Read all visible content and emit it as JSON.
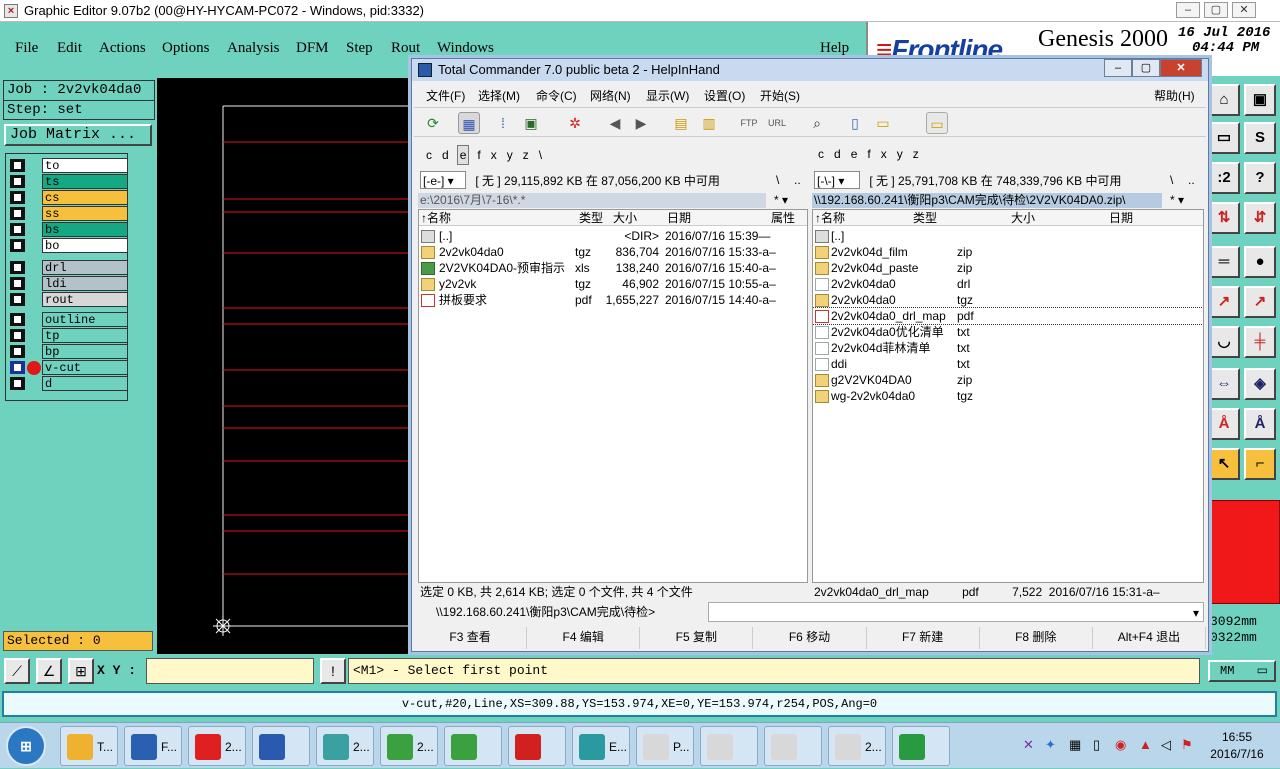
{
  "window": {
    "title": "Graphic Editor 9.07b2 (00@HY-HYCAM-PC072 - Windows, pid:3332)"
  },
  "menu": [
    "File",
    "Edit",
    "Actions",
    "Options",
    "Analysis",
    "DFM",
    "Step",
    "Rout",
    "Windows",
    "Help"
  ],
  "brand": {
    "logo": "Frontline",
    "product": "Genesis 2000",
    "date": "16 Jul 2016",
    "time": "04:44 PM"
  },
  "job": {
    "label": "Job : 2v2vk04da0",
    "step": "Step: set",
    "matrix_button": "Job Matrix ..."
  },
  "layers": [
    {
      "name": "to",
      "color": "#ffffff"
    },
    {
      "name": "ts",
      "color": "#14a883"
    },
    {
      "name": "cs",
      "color": "#f7c03c"
    },
    {
      "name": "ss",
      "color": "#f7c03c"
    },
    {
      "name": "bs",
      "color": "#14a883"
    },
    {
      "name": "bo",
      "color": "#ffffff"
    },
    {
      "name": "drl",
      "color": "#b3c2c8"
    },
    {
      "name": "ldi",
      "color": "#b3c2c8"
    },
    {
      "name": "rout",
      "color": "#d7d7d7"
    },
    {
      "name": "outline",
      "color": "#6ed2bf"
    },
    {
      "name": "tp",
      "color": "#6ed2bf"
    },
    {
      "name": "bp",
      "color": "#6ed2bf"
    },
    {
      "name": "v-cut",
      "color": "#6ed2bf",
      "active": true
    },
    {
      "name": "d",
      "color": "#6ed2bf"
    }
  ],
  "selected": "Selected : 0",
  "coords_right": [
    "3092mm",
    "0322mm"
  ],
  "units": "MM",
  "xy": {
    "label": "X Y :",
    "value": "",
    "prompt": "<M1> - Select first point"
  },
  "status_line": "v-cut,#20,Line,XS=309.88,YS=153.974,XE=0,YE=153.974,r254,POS,Ang=0",
  "tc": {
    "title": "Total Commander 7.0 public beta 2 - HelpInHand",
    "menu": [
      "文件(F)",
      "选择(M)",
      "命令(C)",
      "网络(N)",
      "显示(W)",
      "设置(O)",
      "开始(S)",
      "帮助(H)"
    ],
    "left": {
      "drives": [
        "c",
        "d",
        "e",
        "f",
        "x",
        "y",
        "z",
        "\\"
      ],
      "active_drive": "e",
      "drive_select": "[-e-]",
      "space": "[ 无 ]  29,115,892 KB 在 87,056,200 KB 中可用",
      "path": "e:\\2016\\7月\\7-16\\*.*",
      "headers": [
        "↑名称",
        "类型",
        "大小",
        "日期",
        "属性"
      ],
      "files": [
        {
          "name": "[..]",
          "ext": "",
          "size": "<DIR>",
          "date": "2016/07/16 15:39—",
          "icon": "up"
        },
        {
          "name": "2v2vk04da0",
          "ext": "tgz",
          "size": "836,704",
          "date": "2016/07/16 15:33-a–",
          "icon": "arc"
        },
        {
          "name": "2V2VK04DA0-预审指示",
          "ext": "xls",
          "size": "138,240",
          "date": "2016/07/16 15:40-a–",
          "icon": "xls"
        },
        {
          "name": "y2v2vk",
          "ext": "tgz",
          "size": "46,902",
          "date": "2016/07/15 10:55-a–",
          "icon": "arc"
        },
        {
          "name": "拼板要求",
          "ext": "pdf",
          "size": "1,655,227",
          "date": "2016/07/15 14:40-a–",
          "icon": "pdf"
        }
      ],
      "status": "选定 0 KB, 共 2,614 KB; 选定 0 个文件, 共 4 个文件"
    },
    "right": {
      "drives": [
        "c",
        "d",
        "e",
        "f",
        "x",
        "y",
        "z"
      ],
      "drive_select": "[-\\-]",
      "space": "[ 无 ]  25,791,708 KB 在 748,339,796 KB 中可用",
      "path": "\\\\192.168.60.241\\衡阳p3\\CAM完成\\待检\\2V2VK04DA0.zip\\",
      "headers": [
        "↑名称",
        "类型",
        "大小",
        "日期"
      ],
      "files": [
        {
          "name": "[..]",
          "ext": "",
          "icon": "up"
        },
        {
          "name": "2v2vk04d_film",
          "ext": "zip",
          "icon": "arc"
        },
        {
          "name": "2v2vk04d_paste",
          "ext": "zip",
          "icon": "arc"
        },
        {
          "name": "2v2vk04da0",
          "ext": "drl",
          "icon": "doc"
        },
        {
          "name": "2v2vk04da0",
          "ext": "tgz",
          "icon": "arc"
        },
        {
          "name": "2v2vk04da0_drl_map",
          "ext": "pdf",
          "icon": "pdf",
          "focused": true
        },
        {
          "name": "2v2vk04da0优化清单",
          "ext": "txt",
          "icon": "doc"
        },
        {
          "name": "2v2vk04d菲林清单",
          "ext": "txt",
          "icon": "doc"
        },
        {
          "name": "ddi",
          "ext": "txt",
          "icon": "doc"
        },
        {
          "name": "g2V2VK04DA0",
          "ext": "zip",
          "icon": "arc"
        },
        {
          "name": "wg-2v2vk04da0",
          "ext": "tgz",
          "icon": "arc"
        }
      ],
      "status": "2v2vk04da0_drl_map          pdf          7,522  2016/07/16 15:31-a–"
    },
    "cmd_path": "\\\\192.168.60.241\\衡阳p3\\CAM完成\\待检>",
    "fkeys": [
      "F3 查看",
      "F4 编辑",
      "F5 复制",
      "F6 移动",
      "F7 新建",
      "F8 删除",
      "Alt+F4 退出"
    ]
  },
  "taskbar": {
    "buttons": [
      "T...",
      "F...",
      "2...",
      "",
      "2...",
      "2...",
      "",
      "",
      "E...",
      "P...",
      "",
      "",
      "2...",
      ""
    ],
    "clock_time": "16:55",
    "clock_date": "2016/7/16"
  }
}
